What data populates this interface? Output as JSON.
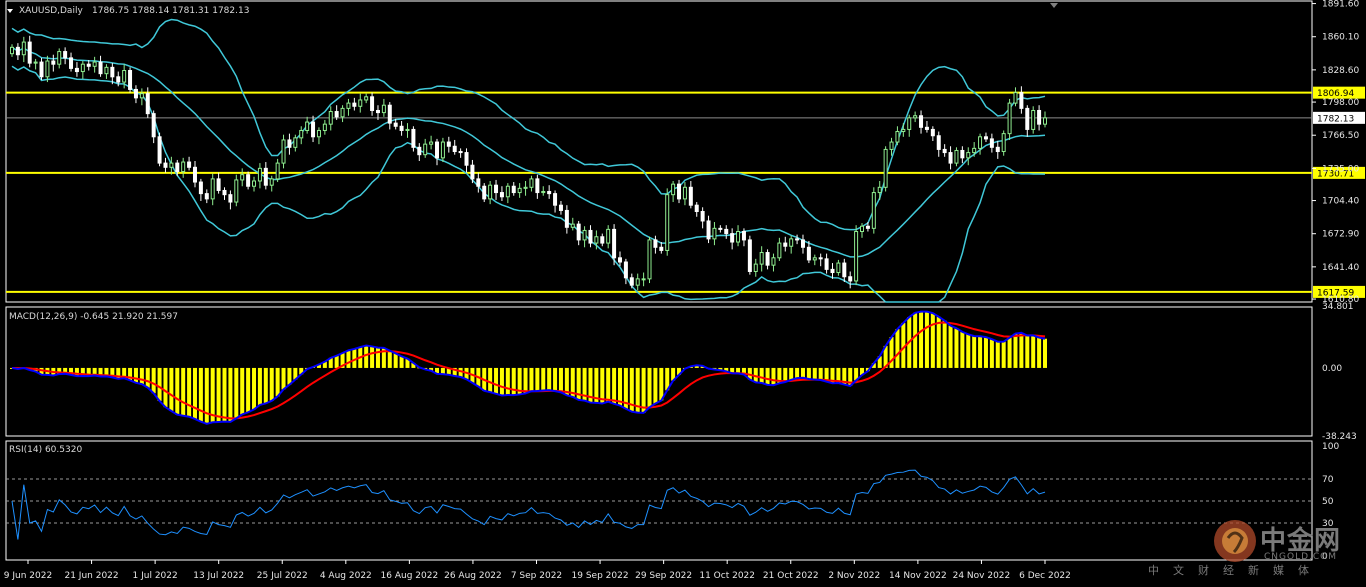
{
  "header": {
    "symbol": "XAUUSD,Daily",
    "ohlc": "1786.75 1788.14 1781.31 1782.13",
    "menu_icon": "triangle-down-icon"
  },
  "price_axis": {
    "ticks": [
      "1891.60",
      "1860.10",
      "1828.60",
      "1798.00",
      "1766.50",
      "1735.00",
      "1704.40",
      "1672.90",
      "1641.40",
      "1610.80"
    ],
    "current_price": "1782.13",
    "levels": [
      "1806.94",
      "1730.71",
      "1617.59"
    ]
  },
  "macd": {
    "label": "MACD(12,26,9) -0.645 21.920 21.597",
    "ticks": [
      "34.801",
      "0.00",
      "-38.243"
    ]
  },
  "rsi": {
    "label": "RSI(14) 60.5320",
    "ticks": [
      "100",
      "70",
      "50",
      "30",
      "0"
    ]
  },
  "time_axis": [
    "9 Jun 2022",
    "21 Jun 2022",
    "1 Jul 2022",
    "13 Jul 2022",
    "25 Jul 2022",
    "4 Aug 2022",
    "16 Aug 2022",
    "26 Aug 2022",
    "7 Sep 2022",
    "19 Sep 2022",
    "29 Sep 2022",
    "11 Oct 2022",
    "21 Oct 2022",
    "2 Nov 2022",
    "14 Nov 2022",
    "24 Nov 2022",
    "6 Dec 2022"
  ],
  "watermark": {
    "title": "中金网",
    "site": "CNGOLD.COM",
    "subtitle": "中文财经新媒体"
  },
  "colors": {
    "background": "#000000",
    "bull_candle": "#90ee90",
    "bear_candle": "#ffffff",
    "bands": "#40c8d8",
    "levels": "#ffff00",
    "macd_hist": "#ffff00",
    "macd_line": "#0000ff",
    "signal_line": "#ff0000",
    "rsi_line": "#1e90ff"
  },
  "chart_data": {
    "type": "candlestick",
    "symbol": "XAUUSD",
    "timeframe": "Daily",
    "ylim": [
      1608,
      1895
    ],
    "horizontal_levels": [
      1806.94,
      1730.71,
      1617.59
    ],
    "closes": [
      1850,
      1843,
      1855,
      1835,
      1836,
      1822,
      1837,
      1834,
      1846,
      1840,
      1830,
      1827,
      1834,
      1832,
      1836,
      1825,
      1831,
      1822,
      1817,
      1828,
      1810,
      1802,
      1806,
      1787,
      1765,
      1740,
      1736,
      1740,
      1732,
      1741,
      1736,
      1722,
      1711,
      1706,
      1725,
      1714,
      1710,
      1703,
      1724,
      1729,
      1718,
      1723,
      1735,
      1719,
      1725,
      1740,
      1762,
      1755,
      1764,
      1771,
      1779,
      1765,
      1771,
      1777,
      1789,
      1784,
      1792,
      1797,
      1794,
      1800,
      1803,
      1790,
      1788,
      1795,
      1778,
      1775,
      1771,
      1772,
      1755,
      1748,
      1758,
      1760,
      1745,
      1760,
      1756,
      1751,
      1750,
      1738,
      1725,
      1718,
      1706,
      1719,
      1712,
      1708,
      1718,
      1712,
      1716,
      1717,
      1725,
      1712,
      1713,
      1711,
      1700,
      1695,
      1679,
      1682,
      1667,
      1676,
      1664,
      1670,
      1664,
      1677,
      1650,
      1646,
      1631,
      1624,
      1630,
      1630,
      1667,
      1660,
      1657,
      1710,
      1720,
      1706,
      1717,
      1700,
      1694,
      1685,
      1668,
      1678,
      1677,
      1673,
      1665,
      1675,
      1667,
      1637,
      1644,
      1655,
      1643,
      1650,
      1664,
      1661,
      1668,
      1667,
      1660,
      1648,
      1650,
      1649,
      1639,
      1636,
      1645,
      1632,
      1628,
      1675,
      1680,
      1678,
      1712,
      1717,
      1753,
      1760,
      1770,
      1772,
      1783,
      1785,
      1774,
      1772,
      1766,
      1753,
      1750,
      1740,
      1752,
      1745,
      1750,
      1754,
      1765,
      1763,
      1755,
      1751,
      1768,
      1797,
      1807,
      1792,
      1772,
      1790,
      1777,
      1783
    ],
    "series_names": [
      "Bollinger Bands",
      "MACD(12,26,9)",
      "RSI(14)"
    ],
    "macd_values": {
      "macd": -0.645,
      "signal": 21.92,
      "hist": 21.597
    },
    "macd_ylim": [
      -38.243,
      34.801
    ],
    "rsi_value": 60.532,
    "rsi_levels": [
      70,
      50,
      30
    ]
  }
}
